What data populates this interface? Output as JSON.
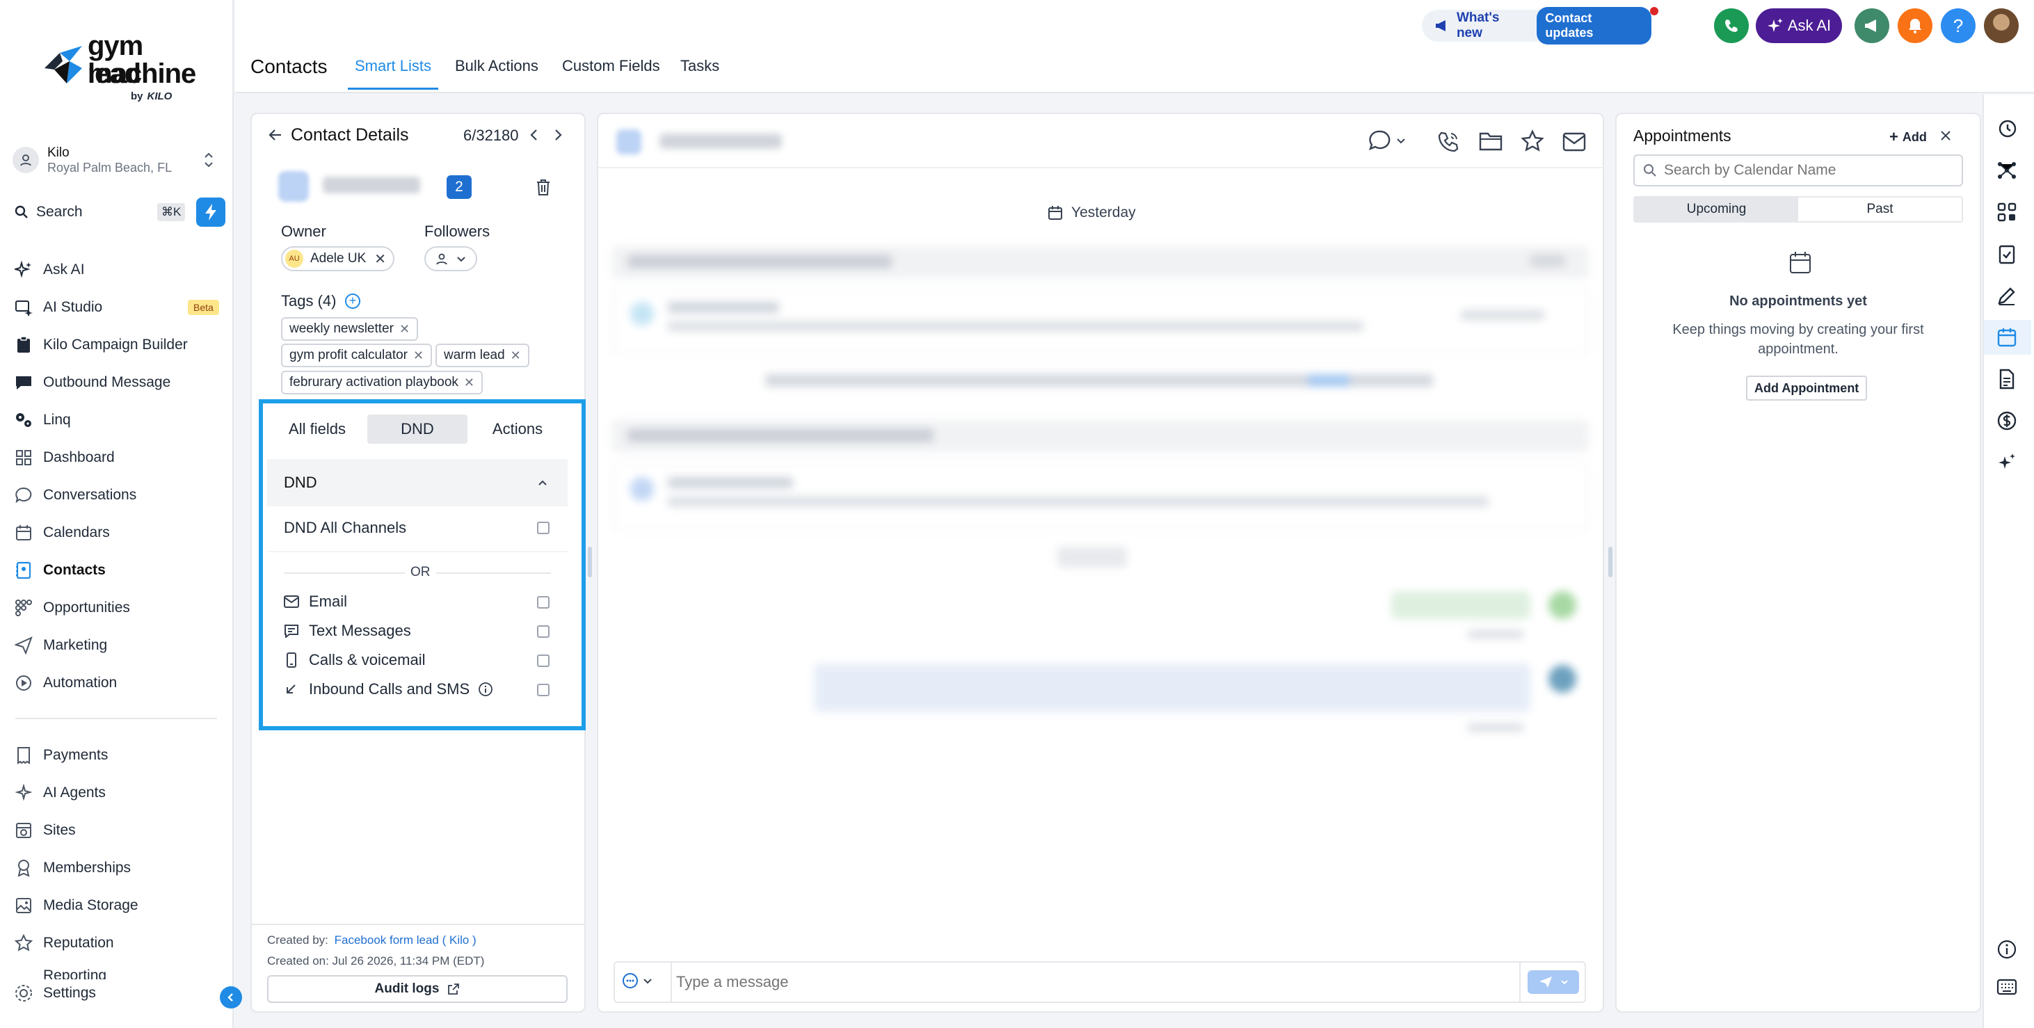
{
  "brand": {
    "line1": "gym lead",
    "line2": "machine",
    "by": "by",
    "company": "KILO"
  },
  "account": {
    "name": "Kilo",
    "location": "Royal Palm Beach, FL"
  },
  "search": {
    "label": "Search",
    "shortcut": "⌘K"
  },
  "sidebar": {
    "items": [
      {
        "label": "Ask AI",
        "icon": "sparkle-icon"
      },
      {
        "label": "AI Studio",
        "icon": "ai-studio-icon",
        "badge": "Beta"
      },
      {
        "label": "Kilo Campaign Builder",
        "icon": "clipboard-icon"
      },
      {
        "label": "Outbound Message",
        "icon": "chat-icon"
      },
      {
        "label": "Linq",
        "icon": "gears-icon"
      },
      {
        "label": "Dashboard",
        "icon": "grid-icon"
      },
      {
        "label": "Conversations",
        "icon": "bubble-icon"
      },
      {
        "label": "Calendars",
        "icon": "calendar-icon"
      },
      {
        "label": "Contacts",
        "icon": "contacts-icon",
        "active": true
      },
      {
        "label": "Opportunities",
        "icon": "opportunities-icon"
      },
      {
        "label": "Marketing",
        "icon": "send-icon"
      },
      {
        "label": "Automation",
        "icon": "automation-icon"
      }
    ],
    "items2": [
      {
        "label": "Payments",
        "icon": "payments-icon"
      },
      {
        "label": "AI Agents",
        "icon": "ai-agents-icon"
      },
      {
        "label": "Sites",
        "icon": "sites-icon"
      },
      {
        "label": "Memberships",
        "icon": "memberships-icon"
      },
      {
        "label": "Media Storage",
        "icon": "media-icon"
      },
      {
        "label": "Reputation",
        "icon": "star-icon"
      },
      {
        "label": "Reporting",
        "icon": "reporting-icon"
      }
    ],
    "settings": "Settings"
  },
  "header": {
    "title": "Contacts",
    "tabs": [
      "Smart Lists",
      "Bulk Actions",
      "Custom Fields",
      "Tasks"
    ],
    "active_tab": "Smart Lists",
    "whats_new": "What's new",
    "contact_updates": "Contact updates",
    "ask_ai": "Ask AI",
    "help": "?"
  },
  "contact": {
    "panel_title": "Contact Details",
    "pager": "6/32180",
    "count_badge": "2",
    "owner_label": "Owner",
    "owner_initials": "AU",
    "owner_name": "Adele UK",
    "followers_label": "Followers",
    "tags_label": "Tags (4)",
    "tags": [
      "weekly newsletter",
      "gym profit calculator",
      "warm lead",
      "februrary activation playbook"
    ],
    "field_tabs": [
      "All fields",
      "DND",
      "Actions"
    ],
    "active_field_tab": "DND",
    "dnd_section": "DND",
    "dnd_all": "DND All Channels",
    "or": "OR",
    "channels": [
      "Email",
      "Text Messages",
      "Calls & voicemail",
      "Inbound Calls and SMS"
    ],
    "created_by_label": "Created by:",
    "created_by_value": "Facebook form lead ( Kilo )",
    "created_on": "Created on: Jul 26 2026, 11:34 PM (EDT)",
    "audit_logs": "Audit logs"
  },
  "conversation": {
    "date_chip": "Yesterday",
    "message_placeholder": "Type a message"
  },
  "appointments": {
    "title": "Appointments",
    "add": "Add",
    "search_placeholder": "Search by Calendar Name",
    "tabs": [
      "Upcoming",
      "Past"
    ],
    "active_tab": "Upcoming",
    "empty_title": "No appointments yet",
    "empty_text": "Keep things moving by creating your first appointment.",
    "add_button": "Add Appointment"
  },
  "colors": {
    "accent": "#1f8be5",
    "highlight_border": "#1e9ee8",
    "ask_ai_bg": "#4c1d95",
    "phone_green": "#1a9a55",
    "megaphone_green": "#3f8a6a",
    "bell_orange": "#f97316",
    "help_blue": "#2d8cf0",
    "beta_bg": "#fde68a"
  }
}
